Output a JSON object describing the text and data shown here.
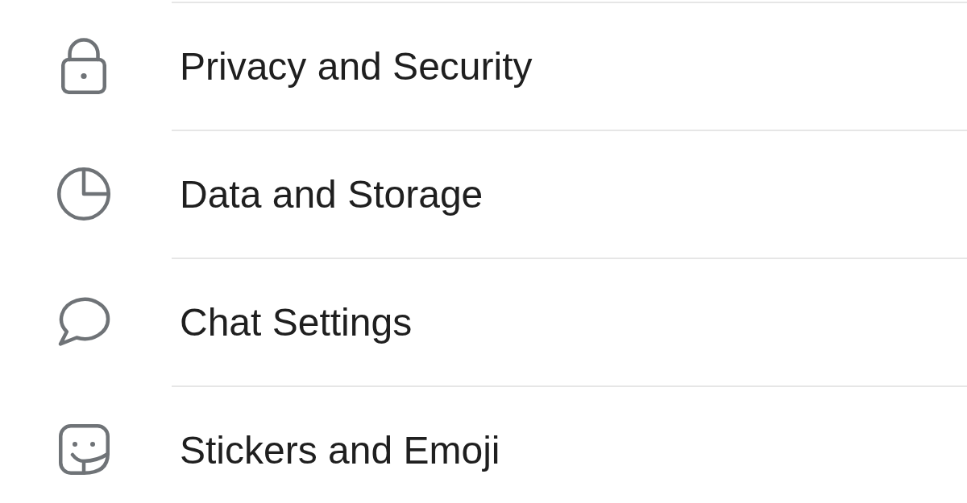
{
  "settings_list": {
    "items": [
      {
        "label": "Privacy and Security"
      },
      {
        "label": "Data and Storage"
      },
      {
        "label": "Chat Settings"
      },
      {
        "label": "Stickers and Emoji"
      }
    ]
  }
}
